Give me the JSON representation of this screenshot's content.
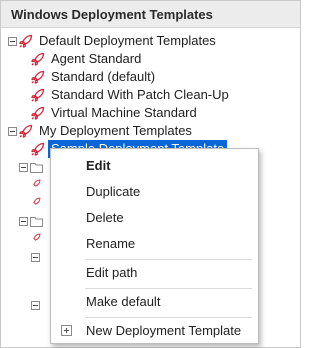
{
  "header": {
    "title": "Windows Deployment Templates"
  },
  "tree": {
    "default_group": "Default Deployment Templates",
    "default_items": [
      "Agent Standard",
      "Standard (default)",
      "Standard With Patch Clean-Up",
      "Virtual Machine Standard"
    ],
    "my_group": "My Deployment Templates",
    "selected_item": "Sample Deployment Template"
  },
  "context_menu": {
    "edit": "Edit",
    "duplicate": "Duplicate",
    "delete": "Delete",
    "rename": "Rename",
    "edit_path": "Edit path",
    "make_default": "Make default",
    "new_template": "New Deployment Template"
  },
  "colors": {
    "rocket": "#d8263a",
    "selection": "#0a66d6"
  },
  "icons": {
    "template": "rocket-icon",
    "group": "folder-icon",
    "new": "plus-icon"
  }
}
